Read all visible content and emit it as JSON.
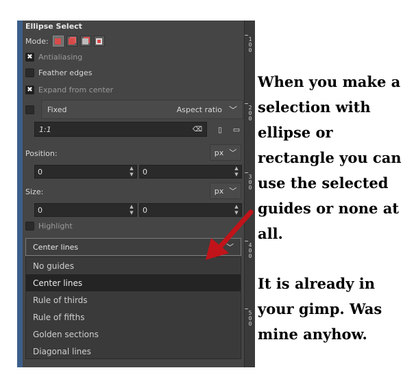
{
  "panel": {
    "title": "Ellipse Select",
    "mode_label": "Mode:",
    "antialiasing_label": "Antialiasing",
    "feather_label": "Feather edges",
    "expand_label": "Expand from center",
    "fixed_label": "Fixed",
    "aspect_label": "Aspect ratio",
    "ratio_value": "1:1",
    "position_label": "Position:",
    "position_unit": "px",
    "position_x": "0",
    "position_y": "0",
    "size_label": "Size:",
    "size_unit": "px",
    "size_w": "0",
    "size_h": "0",
    "highlight_label": "Highlight",
    "guides_selected": "Center lines",
    "guide_options": [
      "No guides",
      "Center lines",
      "Rule of thirds",
      "Rule of fifths",
      "Golden sections",
      "Diagonal lines"
    ]
  },
  "ruler": {
    "marks": [
      "1\n0\n0",
      "2\n0\n0",
      "3\n0\n0",
      "4\n0\n0",
      "5\n0\n0"
    ]
  },
  "annotation": {
    "text1": "When you make a selection with ellipse or rectangle you can use the selected guides or none at all.",
    "text2": "It is already in your gimp. Was mine anyhow."
  },
  "colors": {
    "panel_bg": "#454545",
    "accent_blue": "#3b5f8a",
    "arrow_red": "#c0141a"
  }
}
